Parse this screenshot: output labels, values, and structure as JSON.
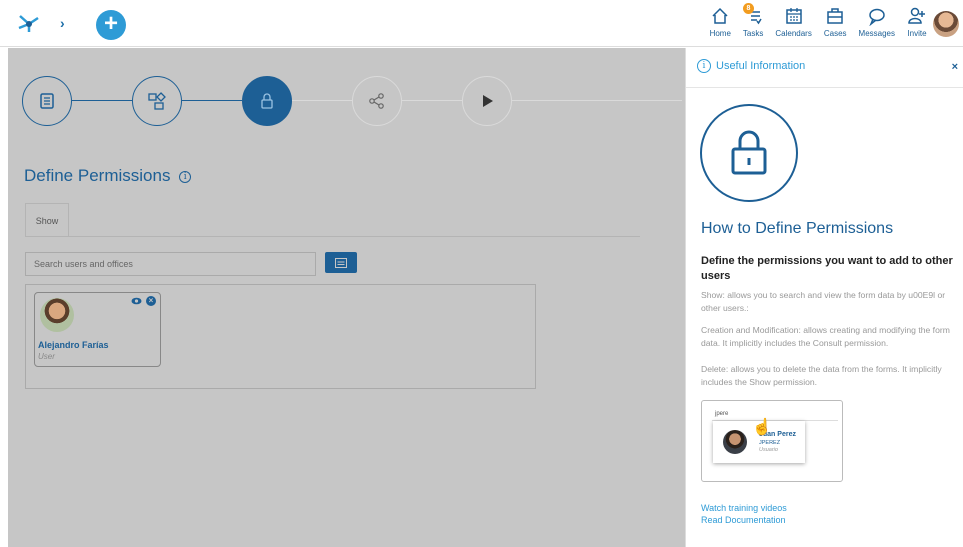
{
  "topbar": {
    "nav": [
      {
        "label": "Home",
        "icon": "home-icon"
      },
      {
        "label": "Tasks",
        "icon": "tasks-icon",
        "badge": "8"
      },
      {
        "label": "Calendars",
        "icon": "calendar-icon"
      },
      {
        "label": "Cases",
        "icon": "briefcase-icon"
      },
      {
        "label": "Messages",
        "icon": "chat-icon"
      },
      {
        "label": "Invite",
        "icon": "invite-icon"
      }
    ]
  },
  "main": {
    "title": "Define Permissions",
    "title_info": "i",
    "tabs": [
      {
        "label": "Show"
      }
    ],
    "search_placeholder": "Search users and offices",
    "users": [
      {
        "name": "Alejandro Farías",
        "role": "User"
      }
    ]
  },
  "panel": {
    "header_icon": "i",
    "header_title": "Useful Information",
    "close": "×",
    "title": "How to Define Permissions",
    "subheading": "Define the permissions you want to add to other users",
    "paragraphs": [
      "Show: allows you to search and view the form data by u00E9l or other users.:",
      "Creation and Modification: allows creating and modifying the form data. It implicitly includes the Consult permission.",
      "Delete: allows you to delete the data from the forms. It implicitly includes the Show permission."
    ],
    "example": {
      "search_text": "jpere",
      "name": "Juan Perez",
      "login": "JPEREZ",
      "role": "Usuario"
    },
    "links": [
      "Watch training videos",
      "Read Documentation"
    ]
  },
  "colors": {
    "primary": "#1d5f95",
    "accent": "#2e9bd6",
    "badge": "#f29c1f",
    "overlay": "#c6c6c6"
  }
}
